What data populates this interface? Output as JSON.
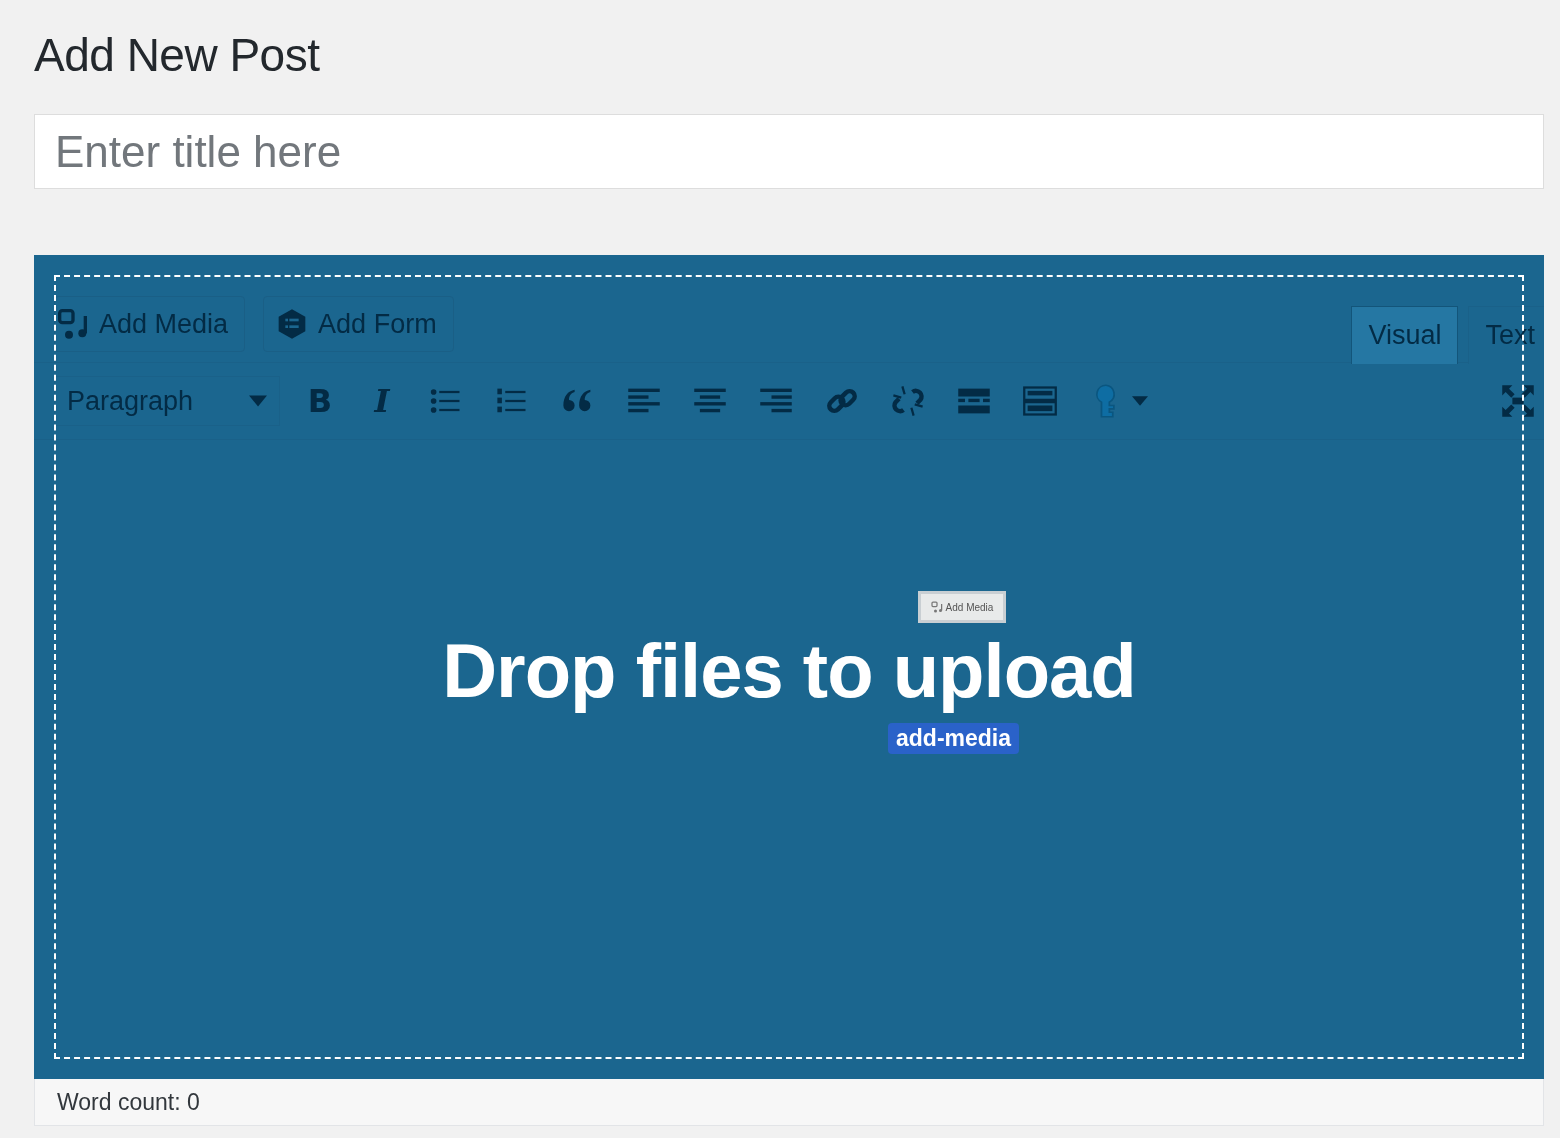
{
  "page_title": "Add New Post",
  "title_field": {
    "placeholder": "Enter title here"
  },
  "editor": {
    "media_buttons": [
      {
        "label": "Add Media",
        "kind": "media"
      },
      {
        "label": "Add Form",
        "kind": "form"
      }
    ],
    "tabs": [
      {
        "label": "Visual",
        "selected": true
      },
      {
        "label": "Text",
        "selected": false
      }
    ],
    "format_select": {
      "value": "Paragraph"
    },
    "bold_label": "B",
    "italic_label": "I",
    "drop_zone": {
      "message": "Drop files to upload",
      "drag_ghost": "Add Media",
      "drag_tooltip": "add-media"
    }
  },
  "status_bar": {
    "word_count": "Word count: 0"
  }
}
